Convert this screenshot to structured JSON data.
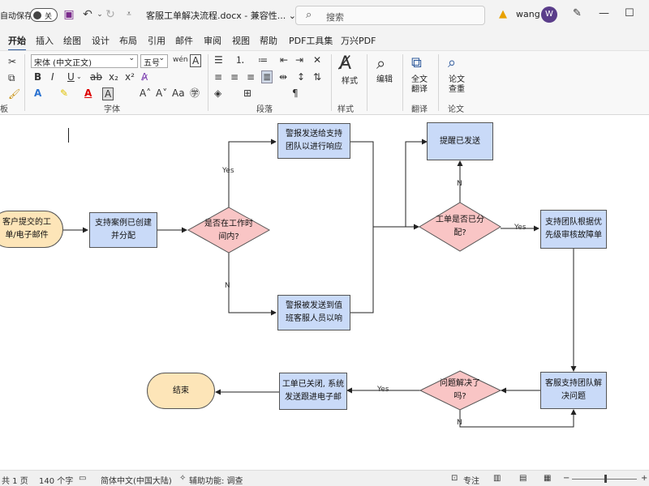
{
  "titlebar": {
    "autosave_label": "自动保存",
    "autosave_state": "关",
    "doc_title": "客服工单解决流程.docx  -  兼容性...  ⌄",
    "search_placeholder": "搜索",
    "user_name": "wang",
    "avatar_letter": "W"
  },
  "tabs": [
    "开始",
    "插入",
    "绘图",
    "设计",
    "布局",
    "引用",
    "邮件",
    "审阅",
    "视图",
    "帮助",
    "PDF工具集",
    "万兴PDF"
  ],
  "ribbon": {
    "font_name": "宋体 (中文正文)",
    "font_size": "五号",
    "group_clipboard": "板",
    "group_font": "字体",
    "group_paragraph": "段落",
    "group_styles": "样式",
    "group_translate": "翻译",
    "group_paper": "论文",
    "styles_label": "样式",
    "edit_label": "编辑",
    "translate_label": "全文\n翻译",
    "paper_label": "论文\n查重"
  },
  "flowchart": {
    "start": "客户提交的工\n单/电子邮件",
    "case_created": "支持案例已创建\n并分配",
    "in_hours": "是否在工作时\n间内?",
    "alert_team": "警报发送给支持\n团队以进行响应",
    "alert_oncall": "警报被发送到值\n班客服人员以响",
    "reminder": "提醒已发送",
    "assigned": "工单是否已分\n配?",
    "prioritize": "支持团队根据优\n先级审核故障单",
    "resolve": "客服支持团队解\n决问题",
    "resolved": "问题解决了\n吗?",
    "closed": "工单已关闭, 系统\n发送跟进电子邮",
    "end": "结束",
    "yes": "Yes",
    "no": "N"
  },
  "status": {
    "pages": "共 1 页",
    "words": "140 个字",
    "lang": "简体中文(中国大陆)",
    "access": "辅助功能: 调查",
    "focus": "专注"
  }
}
